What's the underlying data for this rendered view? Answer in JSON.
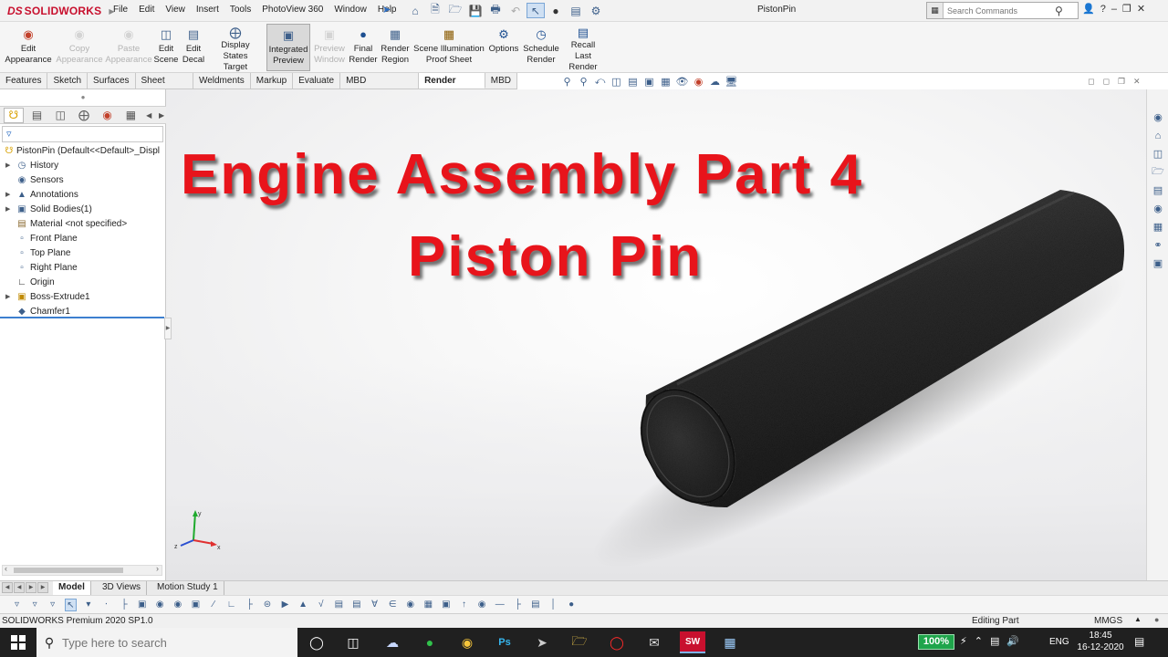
{
  "app": {
    "brand_prefix": "DS",
    "brand_name": "SOLIDWORKS",
    "document_title": "PistonPin"
  },
  "menu": [
    "File",
    "Edit",
    "View",
    "Insert",
    "Tools",
    "PhotoView 360",
    "Window",
    "Help"
  ],
  "search": {
    "placeholder": "Search Commands"
  },
  "ribbon": [
    {
      "label": "Edit\nAppearance",
      "state": "normal",
      "icon": "appearance-ball-icon"
    },
    {
      "label": "Copy\nAppearance",
      "state": "disabled",
      "icon": "copy-appearance-icon"
    },
    {
      "label": "Paste\nAppearance",
      "state": "disabled",
      "icon": "paste-appearance-icon"
    },
    {
      "label": "Edit\nScene",
      "state": "normal",
      "icon": "scene-icon"
    },
    {
      "label": "Edit\nDecal",
      "state": "normal",
      "icon": "decal-icon"
    },
    {
      "label": "Display States\nTarget",
      "state": "normal",
      "icon": "target-icon"
    },
    {
      "label": "Integrated\nPreview",
      "state": "active",
      "icon": "integrated-preview-icon"
    },
    {
      "label": "Preview\nWindow",
      "state": "disabled",
      "icon": "preview-window-icon"
    },
    {
      "label": "Final\nRender",
      "state": "normal",
      "icon": "final-render-icon"
    },
    {
      "label": "Render\nRegion",
      "state": "normal",
      "icon": "render-region-icon"
    },
    {
      "label": "Scene Illumination\nProof Sheet",
      "state": "normal",
      "icon": "proof-sheet-icon"
    },
    {
      "label": "Options",
      "state": "normal",
      "icon": "options-icon"
    },
    {
      "label": "Schedule\nRender",
      "state": "normal",
      "icon": "schedule-render-icon"
    },
    {
      "label": "Recall Last\nRender",
      "state": "normal",
      "icon": "recall-render-icon"
    }
  ],
  "command_tabs": [
    "Features",
    "Sketch",
    "Surfaces",
    "Sheet Metal",
    "Weldments",
    "Markup",
    "Evaluate",
    "MBD Dimensions",
    "Render Tools",
    "MBD"
  ],
  "active_command_tab": "Render Tools",
  "feature_tree": {
    "root": "PistonPin  (Default<<Default>_Displ",
    "items": [
      {
        "label": "History",
        "expandable": true,
        "icon": "history-icon"
      },
      {
        "label": "Sensors",
        "expandable": false,
        "icon": "sensor-icon"
      },
      {
        "label": "Annotations",
        "expandable": true,
        "icon": "annotations-icon"
      },
      {
        "label": "Solid Bodies(1)",
        "expandable": true,
        "icon": "solid-bodies-icon"
      },
      {
        "label": "Material <not specified>",
        "expandable": false,
        "icon": "material-icon"
      },
      {
        "label": "Front Plane",
        "expandable": false,
        "icon": "plane-icon"
      },
      {
        "label": "Top Plane",
        "expandable": false,
        "icon": "plane-icon"
      },
      {
        "label": "Right Plane",
        "expandable": false,
        "icon": "plane-icon"
      },
      {
        "label": "Origin",
        "expandable": false,
        "icon": "origin-icon"
      },
      {
        "label": "Boss-Extrude1",
        "expandable": true,
        "icon": "extrude-icon"
      },
      {
        "label": "Chamfer1",
        "expandable": false,
        "icon": "chamfer-icon"
      }
    ]
  },
  "viewport": {
    "headline_line1": "Engine Assembly Part 4",
    "headline_line2": "Piston Pin",
    "headline_color": "#e8141b",
    "part_color": "#2a2a2a"
  },
  "bottom_tabs": [
    "Model",
    "3D Views",
    "Motion Study 1"
  ],
  "active_bottom_tab": "Model",
  "status": {
    "version": "SOLIDWORKS Premium 2020 SP1.0",
    "mode": "Editing Part",
    "units": "MMGS"
  },
  "taskbar": {
    "search_placeholder": "Type here to search",
    "battery": "100%",
    "language": "ENG",
    "time": "18:45",
    "date": "16-12-2020"
  }
}
